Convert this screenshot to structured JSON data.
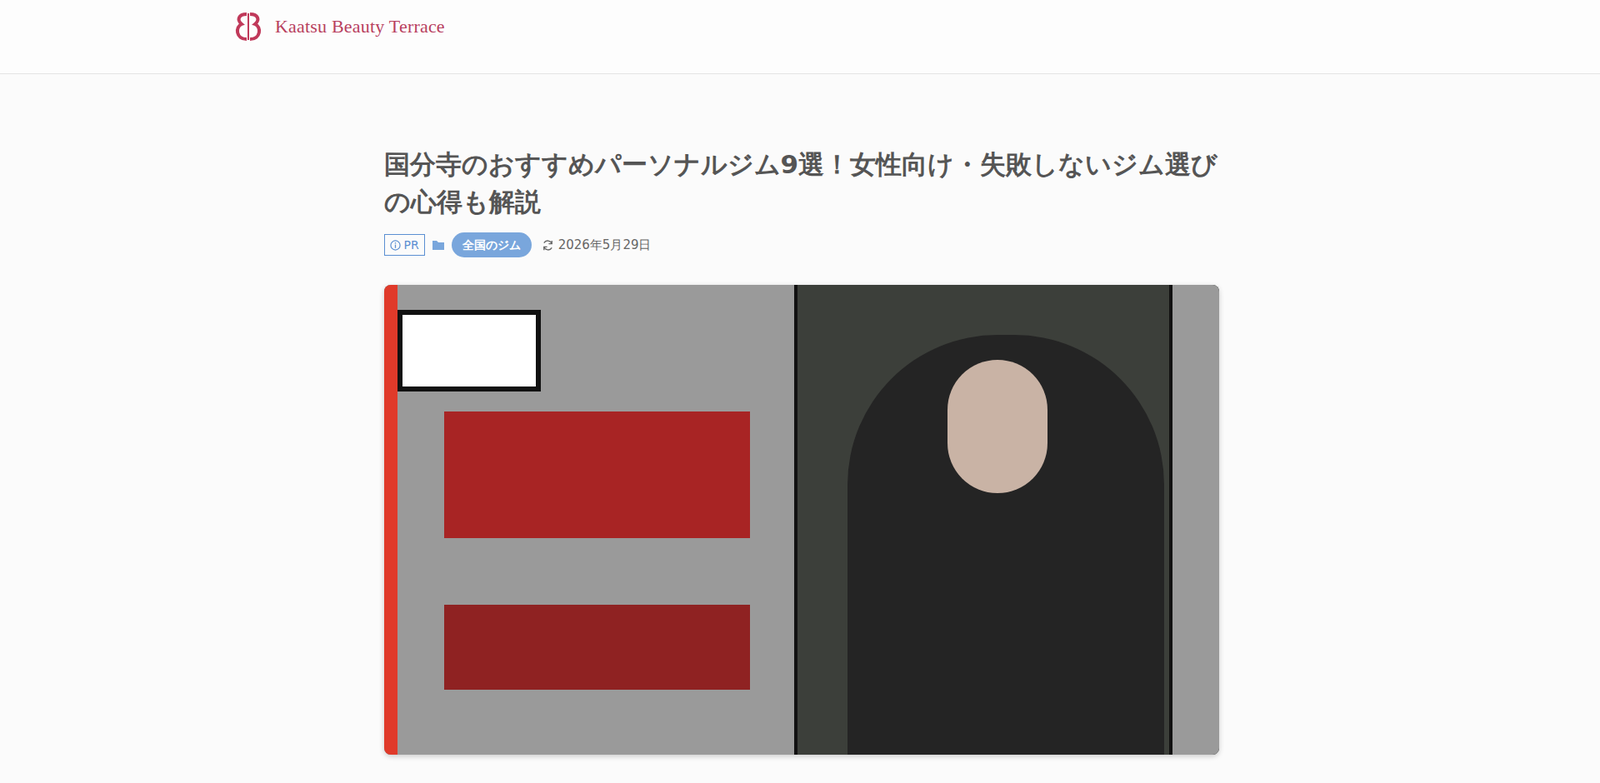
{
  "site": {
    "logo_text": "Kaatsu Beauty Terrace"
  },
  "article": {
    "title": "国分寺のおすすめパーソナルジム9選！女性向け・失敗しないジム選びの心得も解説",
    "meta": {
      "pr_label": "PR",
      "category": "全国のジム",
      "date": "2026年5月29日"
    }
  }
}
